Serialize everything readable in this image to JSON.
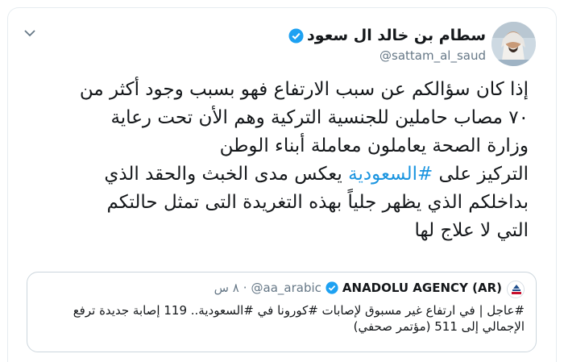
{
  "tweet": {
    "author": {
      "display_name": "سطام بن خالد ال سعود",
      "handle": "@sattam_al_saud",
      "verified": true,
      "avatar_icon": "profile-photo"
    },
    "menu_icon": "chevron-down-icon",
    "text_lines": [
      "إذا كان سؤالكم عن سبب الارتفاع فهو بسبب وجود أكثر من",
      "٧٠ مصاب حاملين للجنسية التركية وهم الأن تحت رعاية",
      "وزارة الصحة يعاملون معاملة أبناء الوطن"
    ],
    "line4_prefix": "التركيز على ",
    "line4_hashtag": "#السعودية",
    "line4_suffix": " يعكس مدى الخبث والحقد الذي",
    "text_lines_end": [
      "بداخلكم الذي يظهر جلياً بهذه التغريدة التى تمثل حالتكم",
      "التي لا علاج لها"
    ]
  },
  "quoted_tweet": {
    "display_name": "ANADOLU AGENCY (AR)",
    "verified": true,
    "handle": "@aa_arabic",
    "dot": "·",
    "time": "٨ س",
    "text_lines": [
      "#عاجل | في ارتفاع غير مسبوق لإصابات #كورونا في #السعودية.. 119 إصابة جديدة ترفع",
      "الإجمالي إلى 511 (مؤتمر صحفي)"
    ]
  },
  "colors": {
    "text": "#14171a",
    "secondary": "#657786",
    "link": "#1b95e0",
    "verified_badge": "#1da1f2",
    "border": "#ccd6dd"
  }
}
